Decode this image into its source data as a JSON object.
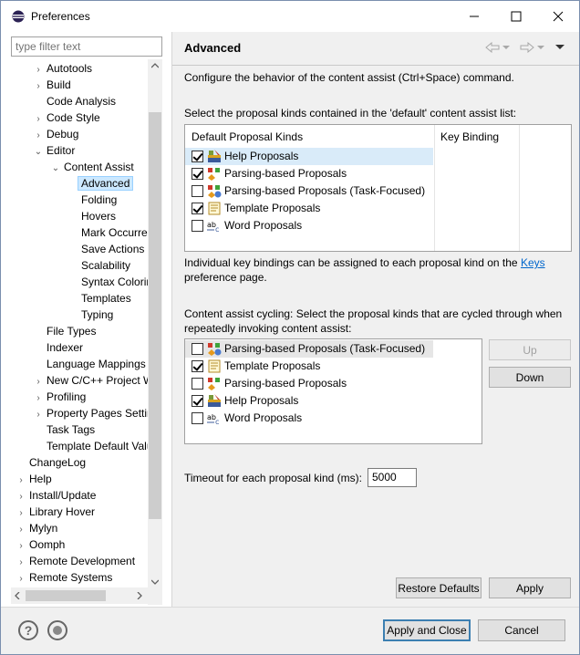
{
  "window": {
    "title": "Preferences"
  },
  "filter": {
    "placeholder": "type filter text"
  },
  "tree": [
    {
      "label": "Autotools",
      "indent": 2,
      "twisty": "›"
    },
    {
      "label": "Build",
      "indent": 2,
      "twisty": "›"
    },
    {
      "label": "Code Analysis",
      "indent": 2,
      "twisty": ""
    },
    {
      "label": "Code Style",
      "indent": 2,
      "twisty": "›"
    },
    {
      "label": "Debug",
      "indent": 2,
      "twisty": "›"
    },
    {
      "label": "Editor",
      "indent": 2,
      "twisty": "⌄"
    },
    {
      "label": "Content Assist",
      "indent": 3,
      "twisty": "⌄"
    },
    {
      "label": "Advanced",
      "indent": 4,
      "twisty": "",
      "selected": true
    },
    {
      "label": "Folding",
      "indent": 4,
      "twisty": ""
    },
    {
      "label": "Hovers",
      "indent": 4,
      "twisty": ""
    },
    {
      "label": "Mark Occurrences",
      "indent": 4,
      "twisty": ""
    },
    {
      "label": "Save Actions",
      "indent": 4,
      "twisty": ""
    },
    {
      "label": "Scalability",
      "indent": 4,
      "twisty": ""
    },
    {
      "label": "Syntax Coloring",
      "indent": 4,
      "twisty": ""
    },
    {
      "label": "Templates",
      "indent": 4,
      "twisty": ""
    },
    {
      "label": "Typing",
      "indent": 4,
      "twisty": ""
    },
    {
      "label": "File Types",
      "indent": 2,
      "twisty": ""
    },
    {
      "label": "Indexer",
      "indent": 2,
      "twisty": ""
    },
    {
      "label": "Language Mappings",
      "indent": 2,
      "twisty": ""
    },
    {
      "label": "New C/C++ Project Wizard",
      "indent": 2,
      "twisty": "›"
    },
    {
      "label": "Profiling",
      "indent": 2,
      "twisty": "›"
    },
    {
      "label": "Property Pages Settings",
      "indent": 2,
      "twisty": "›"
    },
    {
      "label": "Task Tags",
      "indent": 2,
      "twisty": ""
    },
    {
      "label": "Template Default Values",
      "indent": 2,
      "twisty": ""
    },
    {
      "label": "ChangeLog",
      "indent": 1,
      "twisty": ""
    },
    {
      "label": "Help",
      "indent": 1,
      "twisty": "›"
    },
    {
      "label": "Install/Update",
      "indent": 1,
      "twisty": "›"
    },
    {
      "label": "Library Hover",
      "indent": 1,
      "twisty": "›"
    },
    {
      "label": "Mylyn",
      "indent": 1,
      "twisty": "›"
    },
    {
      "label": "Oomph",
      "indent": 1,
      "twisty": "›"
    },
    {
      "label": "Remote Development",
      "indent": 1,
      "twisty": "›"
    },
    {
      "label": "Remote Systems",
      "indent": 1,
      "twisty": "›"
    }
  ],
  "page": {
    "title": "Advanced",
    "description": "Configure the behavior of the content assist (Ctrl+Space) command.",
    "select_label": "Select the proposal kinds contained in the 'default' content assist list:",
    "col_kinds": "Default Proposal Kinds",
    "col_binding": "Key Binding",
    "default_list": [
      {
        "label": "Help Proposals",
        "checked": true,
        "icon": "help-proposals-icon",
        "highlight": true
      },
      {
        "label": "Parsing-based Proposals",
        "checked": true,
        "icon": "parsing-proposals-icon"
      },
      {
        "label": "Parsing-based Proposals (Task-Focused)",
        "checked": false,
        "icon": "task-focused-proposals-icon"
      },
      {
        "label": "Template Proposals",
        "checked": true,
        "icon": "template-proposals-icon"
      },
      {
        "label": "Word Proposals",
        "checked": false,
        "icon": "word-proposals-icon"
      }
    ],
    "keys_note_pre": "Individual key bindings can be assigned to each proposal kind on the",
    "keys_link": "Keys",
    "keys_note_post": "preference page.",
    "cycling_label_1": "Content assist cycling: Select the proposal kinds that are cycled through when",
    "cycling_label_2": "repeatedly invoking content assist:",
    "cycling_list": [
      {
        "label": "Parsing-based Proposals (Task-Focused)",
        "checked": false,
        "icon": "task-focused-proposals-icon",
        "highlight": true
      },
      {
        "label": "Template Proposals",
        "checked": true,
        "icon": "template-proposals-icon"
      },
      {
        "label": "Parsing-based Proposals",
        "checked": false,
        "icon": "parsing-proposals-icon"
      },
      {
        "label": "Help Proposals",
        "checked": true,
        "icon": "help-proposals-icon"
      },
      {
        "label": "Word Proposals",
        "checked": false,
        "icon": "word-proposals-icon"
      }
    ],
    "up_label": "Up",
    "down_label": "Down",
    "timeout_label": "Timeout for each proposal kind (ms):",
    "timeout_value": "5000",
    "restore_label": "Restore Defaults",
    "apply_label": "Apply"
  },
  "footer": {
    "apply_close_label": "Apply and Close",
    "cancel_label": "Cancel"
  }
}
